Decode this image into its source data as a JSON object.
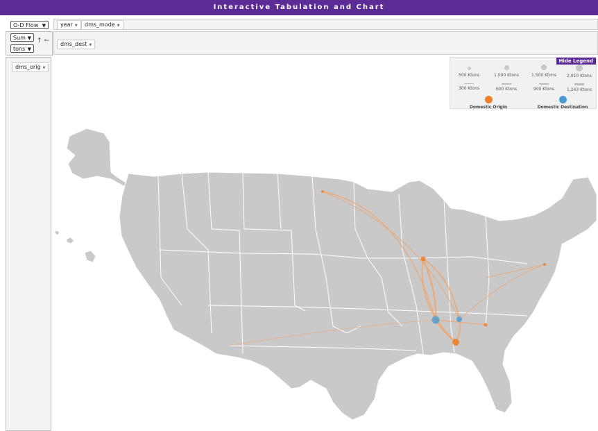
{
  "title": "Interactive Tabulation and Chart",
  "controls": {
    "view_select": "O-D Flow",
    "aggregate_select": "Sum",
    "measure_select": "tons",
    "column_fields": [
      "year",
      "dms_mode"
    ],
    "dest_field": "dms_dest",
    "row_field": "dms_orig"
  },
  "legend": {
    "hide_label": "Hide Legend",
    "circle_sizes": [
      "500 Ktons",
      "1,000 Ktons",
      "1,500 Ktons",
      "2,010 Ktons"
    ],
    "line_widths": [
      "300 Ktons",
      "600 Ktons",
      "900 Ktons",
      "1,243 Ktons"
    ],
    "origin_label": "Domestic Origin",
    "destination_label": "Domestic Destination",
    "origin_color": "#f07f2a",
    "destination_color": "#4a9ad0"
  },
  "icons": {
    "sort": "up-arrow-icon",
    "swap": "left-arrow-icon"
  }
}
